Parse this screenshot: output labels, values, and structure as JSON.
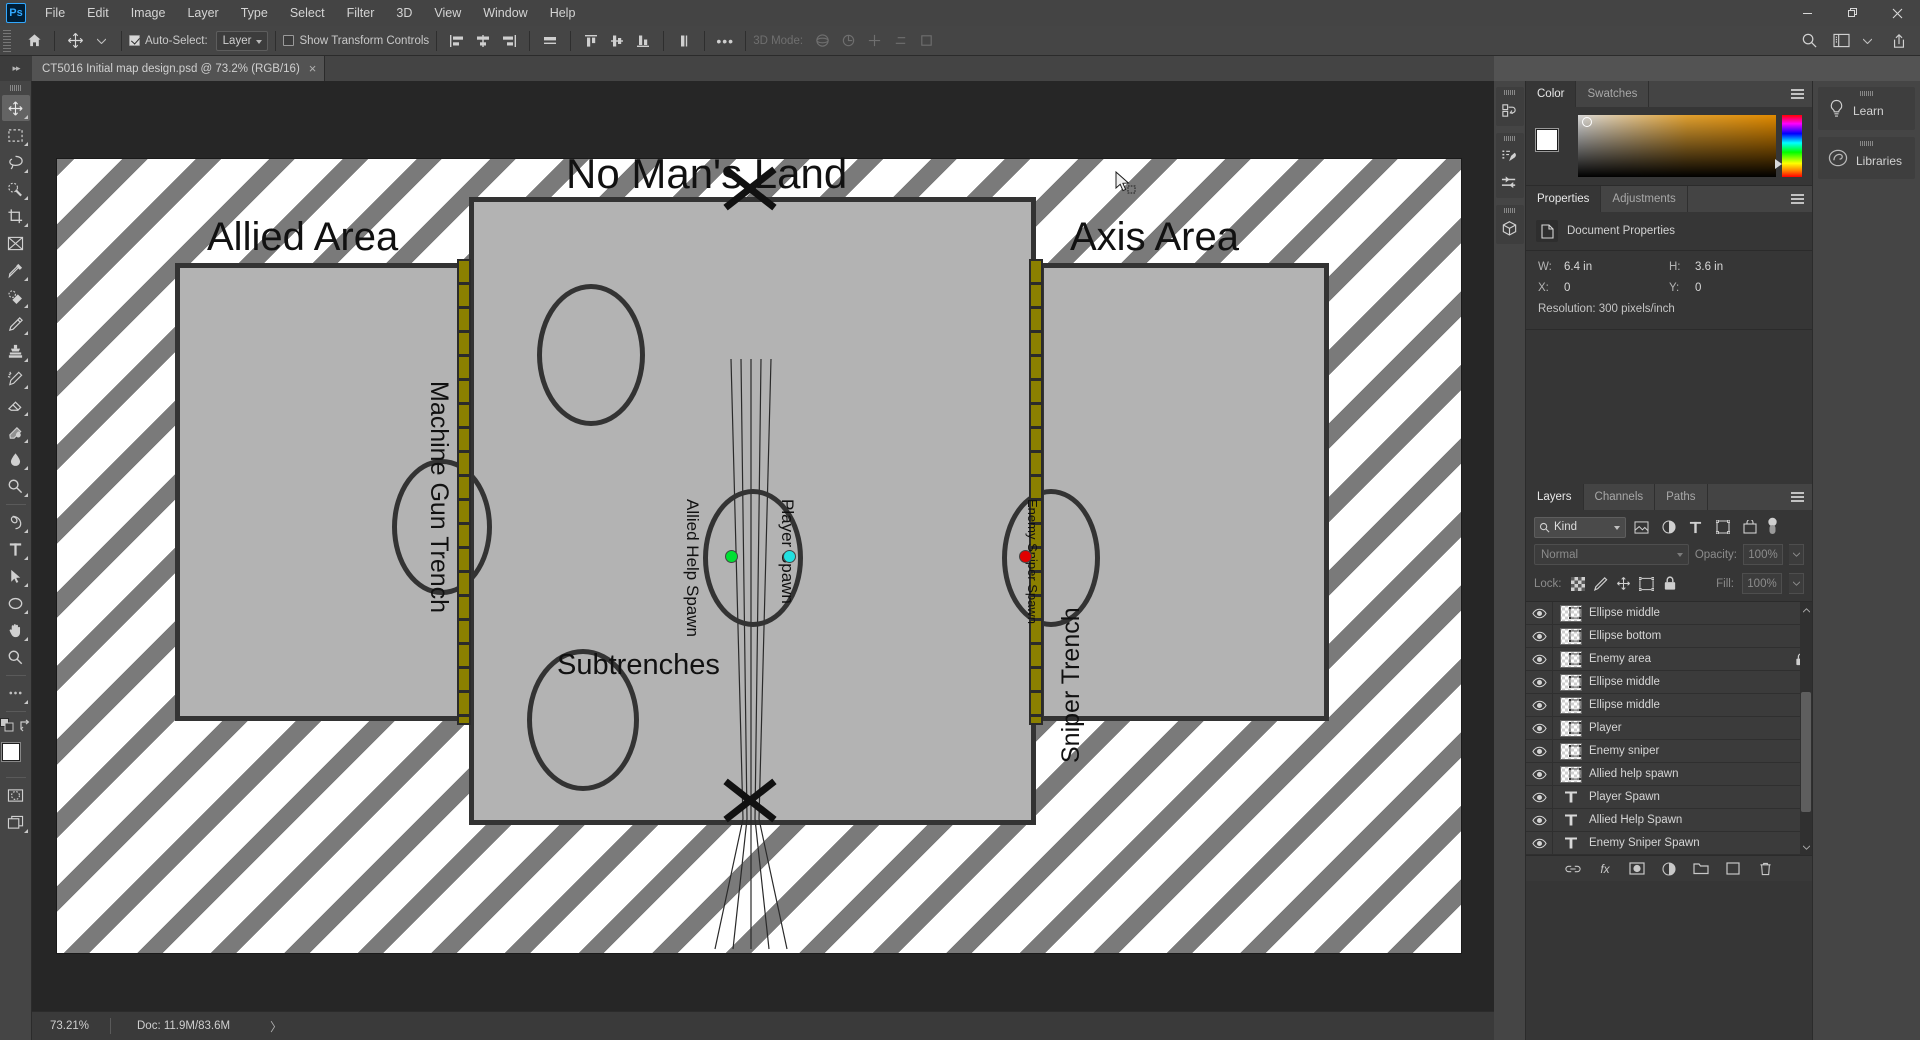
{
  "app": {
    "name": "Adobe Photoshop",
    "logo_text": "Ps"
  },
  "menubar": {
    "items": [
      {
        "label": "File"
      },
      {
        "label": "Edit"
      },
      {
        "label": "Image"
      },
      {
        "label": "Layer"
      },
      {
        "label": "Type"
      },
      {
        "label": "Select"
      },
      {
        "label": "Filter"
      },
      {
        "label": "3D"
      },
      {
        "label": "View"
      },
      {
        "label": "Window"
      },
      {
        "label": "Help"
      }
    ]
  },
  "window_controls": {
    "minimize": "–",
    "maximize": "❐",
    "close": "✕"
  },
  "options_bar": {
    "home_icon": "home-icon",
    "tool_icon": "move-tool-icon",
    "auto_select_label": "Auto-Select:",
    "auto_select_checked": true,
    "auto_select_scope": "Layer",
    "show_transform_label": "Show Transform Controls",
    "show_transform_checked": false,
    "more_label": "•••",
    "mode_3d_label": "3D Mode:",
    "search_icon": "search-icon",
    "workspace_icon": "workspace-icon",
    "share_icon": "share-icon"
  },
  "tabbar": {
    "arrow_label": "▸▸",
    "tabs": [
      {
        "title": "CT5016 Initial map design.psd @ 73.2% (RGB/16)",
        "close": "×",
        "active": true
      }
    ]
  },
  "toolbar": {
    "tools": [
      {
        "name": "move-tool",
        "active": true,
        "more": true
      },
      {
        "name": "rectangular-marquee-tool",
        "active": false,
        "more": true
      },
      {
        "name": "lasso-tool",
        "active": false,
        "more": true
      },
      {
        "name": "quick-selection-tool",
        "active": false,
        "more": true
      },
      {
        "name": "crop-tool",
        "active": false,
        "more": true
      },
      {
        "name": "frame-tool",
        "active": false,
        "more": false
      },
      {
        "name": "eyedropper-tool",
        "active": false,
        "more": true
      },
      {
        "name": "spot-healing-brush-tool",
        "active": false,
        "more": true
      },
      {
        "name": "brush-tool",
        "active": false,
        "more": true
      },
      {
        "name": "clone-stamp-tool",
        "active": false,
        "more": true
      },
      {
        "name": "history-brush-tool",
        "active": false,
        "more": true
      },
      {
        "name": "eraser-tool",
        "active": false,
        "more": true
      },
      {
        "name": "gradient-tool",
        "active": false,
        "more": true
      },
      {
        "name": "blur-tool",
        "active": false,
        "more": true
      },
      {
        "name": "dodge-tool",
        "active": false,
        "more": true
      },
      {
        "name": "pen-tool",
        "active": false,
        "more": true
      },
      {
        "name": "type-tool",
        "active": false,
        "more": true
      },
      {
        "name": "path-selection-tool",
        "active": false,
        "more": true
      },
      {
        "name": "ellipse-tool",
        "active": false,
        "more": true
      },
      {
        "name": "hand-tool",
        "active": false,
        "more": true
      },
      {
        "name": "zoom-tool",
        "active": false,
        "more": false
      },
      {
        "name": "edit-toolbar",
        "active": false,
        "more": true
      }
    ],
    "foreground_color": "#ffffff",
    "background_color": "#3b2a1e",
    "quick-mask": "quick-mask-icon",
    "screen-mode": "screen-mode-icon"
  },
  "canvas": {
    "document_name": "CT5016 Initial map design.psd",
    "map": {
      "areas": [
        {
          "label": "Allied Area"
        },
        {
          "label": "Axis Area"
        },
        {
          "label": "No Man's Land"
        }
      ],
      "sub_labels": [
        {
          "label": "Subtrenches"
        }
      ],
      "vertical_labels": [
        {
          "label": "Machine Gun Trench"
        },
        {
          "label": "Sniper Trench"
        },
        {
          "label": "Allied Help Spawn"
        },
        {
          "label": "Player Spawn"
        },
        {
          "label": "Enemy Sniper Spawn"
        }
      ],
      "spawn_points": [
        {
          "name": "allied-help-spawn",
          "color": "#00e033"
        },
        {
          "name": "player-spawn",
          "color": "#22e0e0"
        },
        {
          "name": "enemy-sniper-spawn",
          "color": "#e00000"
        }
      ],
      "colors": {
        "area_fill": "#b3b3b3",
        "outline": "#333333",
        "trench": "#8b8000",
        "hatch_stripe": "#7a7a7a",
        "hatch_base": "#ffffff"
      }
    }
  },
  "statusbar": {
    "zoom": "73.21%",
    "doc": "Doc: 11.9M/83.6M",
    "arrow": "〉"
  },
  "dock_rail": {
    "buttons": [
      {
        "name": "history-icon"
      },
      {
        "name": "brush-settings-icon"
      },
      {
        "name": "adjustments-sliders-icon"
      },
      {
        "name": "3d-cube-icon"
      }
    ]
  },
  "color_panel": {
    "tabs": [
      {
        "label": "Color",
        "active": true
      },
      {
        "label": "Swatches",
        "active": false
      }
    ],
    "foreground_color": "#ffffff",
    "background_color": "#3b2a1e"
  },
  "properties_panel": {
    "tabs": [
      {
        "label": "Properties",
        "active": true
      },
      {
        "label": "Adjustments",
        "active": false
      }
    ],
    "header": "Document Properties",
    "fields": [
      {
        "key": "W:",
        "value": "6.4 in"
      },
      {
        "key": "H:",
        "value": "3.6 in"
      },
      {
        "key": "X:",
        "value": "0"
      },
      {
        "key": "Y:",
        "value": "0"
      }
    ],
    "resolution": "Resolution: 300 pixels/inch"
  },
  "layers_panel": {
    "tabs": [
      {
        "label": "Layers",
        "active": true
      },
      {
        "label": "Channels",
        "active": false
      },
      {
        "label": "Paths",
        "active": false
      }
    ],
    "filter_label": "Kind",
    "filter_icons": [
      {
        "name": "filter-pixel-icon"
      },
      {
        "name": "filter-adjustment-icon"
      },
      {
        "name": "filter-type-icon"
      },
      {
        "name": "filter-shape-icon"
      },
      {
        "name": "filter-smart-object-icon"
      }
    ],
    "blend_mode": "Normal",
    "opacity_label": "Opacity:",
    "opacity_value": "100%",
    "lock_label": "Lock:",
    "fill_label": "Fill:",
    "fill_value": "100%",
    "lock_icons": [
      {
        "name": "lock-transparent-pixels-icon"
      },
      {
        "name": "lock-image-pixels-icon"
      },
      {
        "name": "lock-position-icon"
      },
      {
        "name": "lock-artboard-nesting-icon"
      },
      {
        "name": "lock-all-icon"
      }
    ],
    "layers": [
      {
        "name": "Enemy Sniper Spawn",
        "type": "text",
        "visible": true,
        "locked": false
      },
      {
        "name": "Allied Help Spawn",
        "type": "text",
        "visible": true,
        "locked": false
      },
      {
        "name": "Player Spawn",
        "type": "text",
        "visible": true,
        "locked": false
      },
      {
        "name": "Allied help spawn",
        "type": "pixel",
        "visible": true,
        "locked": false
      },
      {
        "name": "Enemy sniper",
        "type": "pixel",
        "visible": true,
        "locked": false
      },
      {
        "name": "Player",
        "type": "pixel",
        "visible": true,
        "locked": false
      },
      {
        "name": "Ellipse middle",
        "type": "pixel",
        "visible": true,
        "locked": false
      },
      {
        "name": "Ellipse middle",
        "type": "pixel",
        "visible": true,
        "locked": false
      },
      {
        "name": "Enemy area",
        "type": "pixel",
        "visible": true,
        "locked": true
      },
      {
        "name": "Ellipse bottom",
        "type": "pixel",
        "visible": true,
        "locked": false
      },
      {
        "name": "Ellipse middle",
        "type": "pixel",
        "visible": true,
        "locked": false
      }
    ],
    "footer_buttons": [
      {
        "name": "link-layers-icon"
      },
      {
        "name": "layer-style-icon"
      },
      {
        "name": "layer-mask-icon"
      },
      {
        "name": "adjustment-layer-icon"
      },
      {
        "name": "new-group-icon"
      },
      {
        "name": "new-layer-icon"
      },
      {
        "name": "delete-layer-icon"
      }
    ]
  },
  "mini_dock": {
    "items": [
      {
        "label": "Learn",
        "icon": "lightbulb-icon"
      },
      {
        "label": "Libraries",
        "icon": "creative-cloud-icon"
      }
    ]
  }
}
